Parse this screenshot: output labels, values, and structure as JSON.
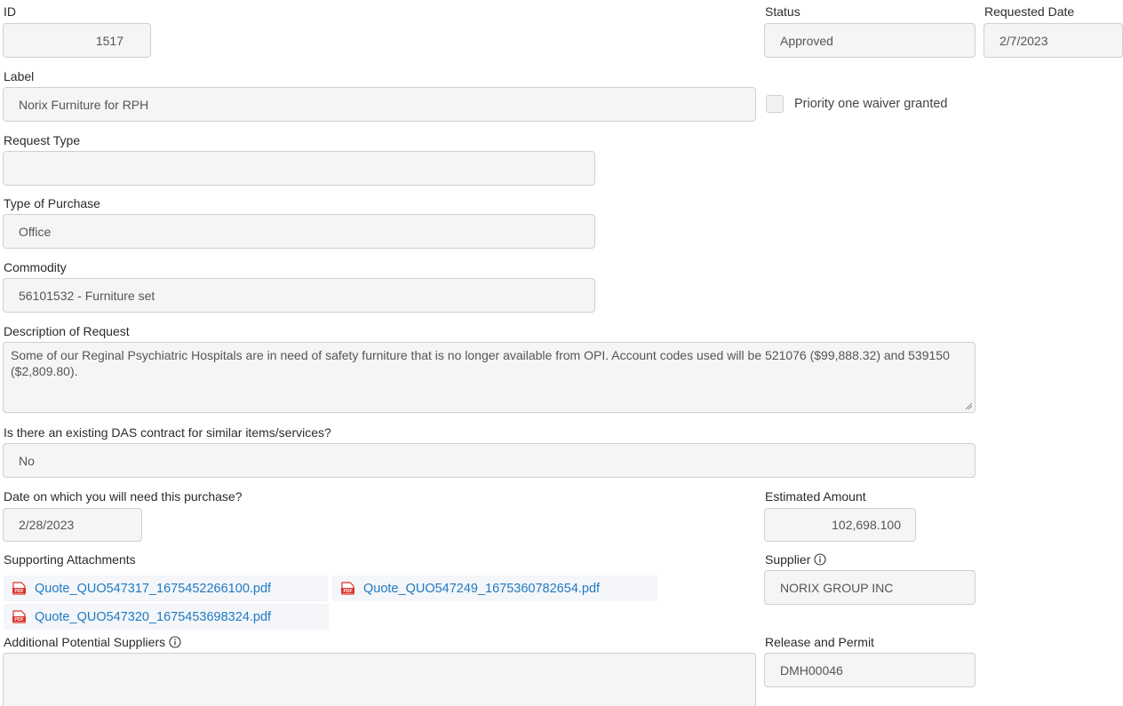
{
  "fields": {
    "id": {
      "label": "ID",
      "value": "1517"
    },
    "status": {
      "label": "Status",
      "value": "Approved"
    },
    "requested_date": {
      "label": "Requested Date",
      "value": "2/7/2023"
    },
    "label": {
      "label": "Label",
      "value": "Norix Furniture for RPH"
    },
    "priority_waiver": {
      "label": "Priority one waiver granted",
      "checked": false
    },
    "request_type": {
      "label": "Request Type",
      "value": ""
    },
    "type_of_purchase": {
      "label": "Type of Purchase",
      "value": "Office"
    },
    "commodity": {
      "label": "Commodity",
      "value": "56101532 - Furniture set"
    },
    "description": {
      "label": "Description of Request",
      "value": "Some of our Reginal Psychiatric Hospitals are in need of safety furniture that is no longer available from OPI. Account codes used will be 521076 ($99,888.32) and 539150 ($2,809.80)."
    },
    "das_contract": {
      "label": "Is there an existing DAS contract for similar items/services?",
      "value": "No"
    },
    "need_date": {
      "label": "Date on which you will need this purchase?",
      "value": "2/28/2023"
    },
    "estimated_amount": {
      "label": "Estimated Amount",
      "value": "102,698.100"
    },
    "supporting_attachments": {
      "label": "Supporting Attachments",
      "files": [
        "Quote_QUO547317_1675452266100.pdf",
        "Quote_QUO547249_1675360782654.pdf",
        "Quote_QUO547320_1675453698324.pdf"
      ]
    },
    "supplier": {
      "label": "Supplier",
      "value": "NORIX GROUP INC"
    },
    "additional_suppliers": {
      "label": "Additional Potential Suppliers",
      "value": ""
    },
    "release_permit": {
      "label": "Release and Permit",
      "value": "DMH00046"
    }
  },
  "icons": {
    "info": "info-circle-icon",
    "pdf": "pdf-file-icon",
    "pdf_color": "#d9342b",
    "link_color": "#1f7ac4"
  }
}
